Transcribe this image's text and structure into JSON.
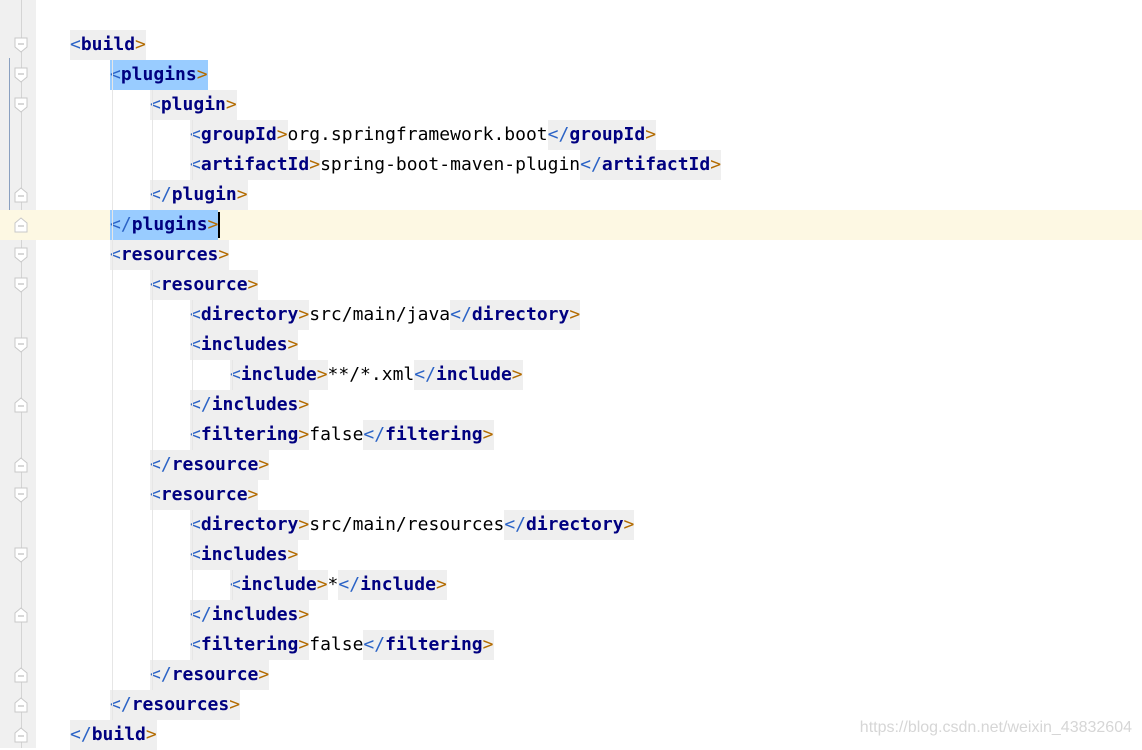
{
  "editor": {
    "lines": [
      {
        "indent": 0,
        "fold": "open",
        "tokens": [
          {
            "t": "tag",
            "text": "build"
          }
        ]
      },
      {
        "indent": 1,
        "fold": "open",
        "tokens": [
          {
            "t": "tag",
            "text": "plugins",
            "hl": true
          }
        ]
      },
      {
        "indent": 2,
        "fold": "open",
        "tokens": [
          {
            "t": "tag",
            "text": "plugin"
          }
        ]
      },
      {
        "indent": 3,
        "fold": "none",
        "tokens": [
          {
            "t": "tag",
            "text": "groupId"
          },
          {
            "t": "text",
            "text": "org.springframework.boot"
          },
          {
            "t": "ctag",
            "text": "groupId"
          }
        ]
      },
      {
        "indent": 3,
        "fold": "none",
        "tokens": [
          {
            "t": "tag",
            "text": "artifactId"
          },
          {
            "t": "text",
            "text": "spring-boot-maven-plugin"
          },
          {
            "t": "ctag",
            "text": "artifactId"
          }
        ]
      },
      {
        "indent": 2,
        "fold": "close",
        "tokens": [
          {
            "t": "ctag",
            "text": "plugin"
          }
        ]
      },
      {
        "indent": 1,
        "fold": "close",
        "current": true,
        "cursor": true,
        "tokens": [
          {
            "t": "ctag",
            "text": "plugins",
            "hl": true
          }
        ]
      },
      {
        "indent": 1,
        "fold": "open",
        "tokens": [
          {
            "t": "tag",
            "text": "resources"
          }
        ]
      },
      {
        "indent": 2,
        "fold": "open",
        "tokens": [
          {
            "t": "tag",
            "text": "resource"
          }
        ]
      },
      {
        "indent": 3,
        "fold": "none",
        "tokens": [
          {
            "t": "tag",
            "text": "directory"
          },
          {
            "t": "text",
            "text": "src/main/java"
          },
          {
            "t": "ctag",
            "text": "directory"
          }
        ]
      },
      {
        "indent": 3,
        "fold": "open",
        "tokens": [
          {
            "t": "tag",
            "text": "includes"
          }
        ]
      },
      {
        "indent": 4,
        "fold": "none",
        "tokens": [
          {
            "t": "tag",
            "text": "include"
          },
          {
            "t": "text",
            "text": "**/*.xml"
          },
          {
            "t": "ctag",
            "text": "include"
          }
        ]
      },
      {
        "indent": 3,
        "fold": "close",
        "tokens": [
          {
            "t": "ctag",
            "text": "includes"
          }
        ]
      },
      {
        "indent": 3,
        "fold": "none",
        "tokens": [
          {
            "t": "tag",
            "text": "filtering"
          },
          {
            "t": "text",
            "text": "false"
          },
          {
            "t": "ctag",
            "text": "filtering"
          }
        ]
      },
      {
        "indent": 2,
        "fold": "close",
        "tokens": [
          {
            "t": "ctag",
            "text": "resource"
          }
        ]
      },
      {
        "indent": 2,
        "fold": "open",
        "tokens": [
          {
            "t": "tag",
            "text": "resource"
          }
        ]
      },
      {
        "indent": 3,
        "fold": "none",
        "tokens": [
          {
            "t": "tag",
            "text": "directory"
          },
          {
            "t": "text",
            "text": "src/main/resources"
          },
          {
            "t": "ctag",
            "text": "directory"
          }
        ]
      },
      {
        "indent": 3,
        "fold": "open",
        "tokens": [
          {
            "t": "tag",
            "text": "includes"
          }
        ]
      },
      {
        "indent": 4,
        "fold": "none",
        "tokens": [
          {
            "t": "tag",
            "text": "include"
          },
          {
            "t": "text",
            "text": "*"
          },
          {
            "t": "ctag",
            "text": "include"
          }
        ]
      },
      {
        "indent": 3,
        "fold": "close",
        "tokens": [
          {
            "t": "ctag",
            "text": "includes"
          }
        ]
      },
      {
        "indent": 3,
        "fold": "none",
        "tokens": [
          {
            "t": "tag",
            "text": "filtering"
          },
          {
            "t": "text",
            "text": "false"
          },
          {
            "t": "ctag",
            "text": "filtering"
          }
        ]
      },
      {
        "indent": 2,
        "fold": "close",
        "tokens": [
          {
            "t": "ctag",
            "text": "resource"
          }
        ]
      },
      {
        "indent": 1,
        "fold": "close",
        "tokens": [
          {
            "t": "ctag",
            "text": "resources"
          }
        ]
      },
      {
        "indent": 0,
        "fold": "close",
        "tokens": [
          {
            "t": "ctag",
            "text": "build"
          }
        ]
      }
    ]
  },
  "watermark": "https://blog.csdn.net/weixin_43832604",
  "colors": {
    "tag_bg": "#efefef",
    "highlight": "#99ccff",
    "current_line": "#fdf8e3",
    "tag_name": "#000080"
  }
}
